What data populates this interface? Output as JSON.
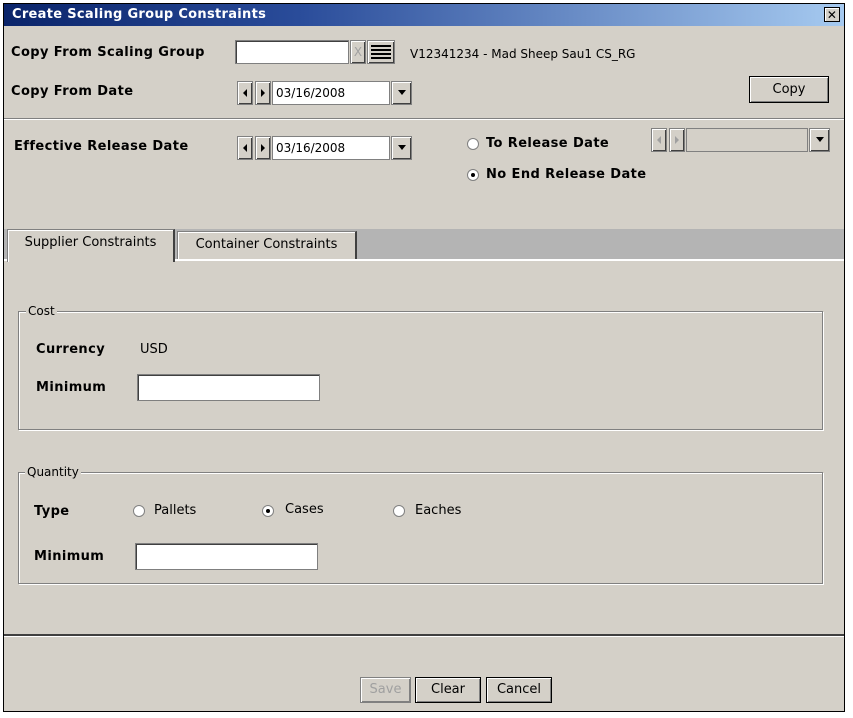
{
  "window": {
    "title": "Create Scaling Group Constraints",
    "close_glyph": "✕"
  },
  "copy_from": {
    "scaling_group_label": "Copy From Scaling Group",
    "scaling_group_value": "",
    "scaling_group_name": "V12341234 - Mad Sheep Sau1 CS_RG",
    "clear_glyph": "X",
    "date_label": "Copy From Date",
    "date_value": "03/16/2008",
    "copy_button": "Copy"
  },
  "release": {
    "effective_label": "Effective Release Date",
    "effective_value": "03/16/2008",
    "to_release_label": "To Release Date",
    "to_release_value": "",
    "no_end_label": "No End Release Date",
    "selected": "No End Release Date"
  },
  "tabs": [
    {
      "label": "Supplier Constraints",
      "active": true
    },
    {
      "label": "Container Constraints",
      "active": false
    }
  ],
  "cost": {
    "legend": "Cost",
    "currency_label": "Currency",
    "currency_value": "USD",
    "minimum_label": "Minimum",
    "minimum_value": ""
  },
  "quantity": {
    "legend": "Quantity",
    "type_label": "Type",
    "options": [
      "Pallets",
      "Cases",
      "Eaches"
    ],
    "selected": "Cases",
    "minimum_label": "Minimum",
    "minimum_value": ""
  },
  "footer": {
    "save_label": "Save",
    "clear_label": "Clear",
    "cancel_label": "Cancel"
  },
  "icons": {
    "left_arrow": "left-arrow-icon",
    "right_arrow": "right-arrow-icon",
    "dropdown": "chevron-down-icon",
    "list": "list-icon"
  }
}
